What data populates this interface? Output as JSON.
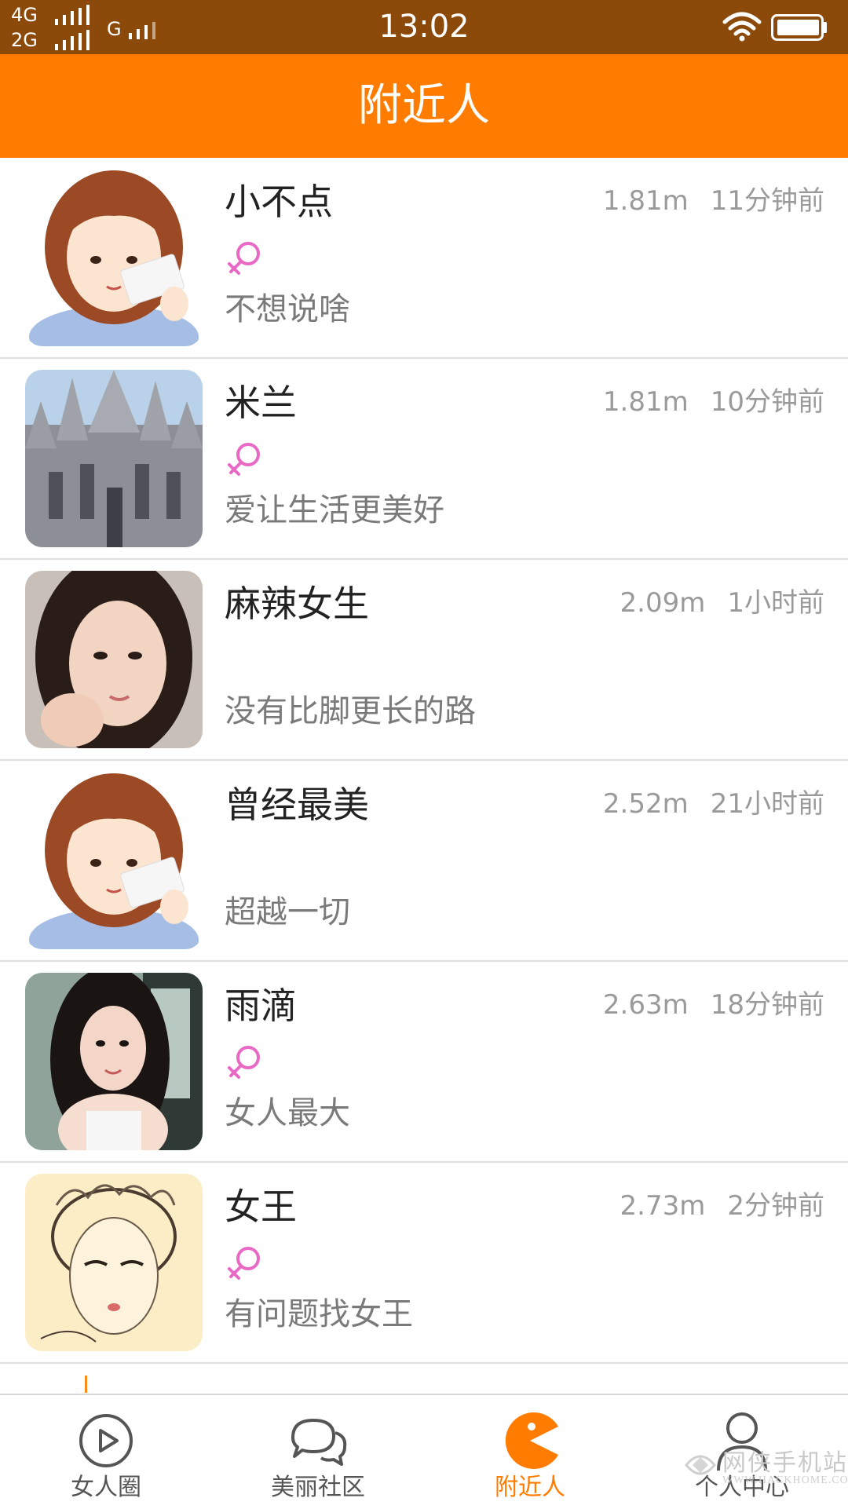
{
  "status_bar": {
    "network_top": "4G",
    "network_bottom": "2G",
    "network_g": "G",
    "time": "13:02"
  },
  "header": {
    "title": "附近人"
  },
  "users": [
    {
      "name": "小不点",
      "distance": "1.81m",
      "time": "11分钟前",
      "signature": "不想说啥",
      "gender": "female",
      "avatar": "cartoon-girl-avatar"
    },
    {
      "name": "米兰",
      "distance": "1.81m",
      "time": "10分钟前",
      "signature": "爱让生活更美好",
      "gender": "female",
      "avatar": "cathedral-photo-avatar"
    },
    {
      "name": "麻辣女生",
      "distance": "2.09m",
      "time": "1小时前",
      "signature": "没有比脚更长的路",
      "gender": "",
      "avatar": "girl-photo-avatar"
    },
    {
      "name": "曾经最美",
      "distance": "2.52m",
      "time": "21小时前",
      "signature": "超越一切",
      "gender": "",
      "avatar": "cartoon-girl-avatar"
    },
    {
      "name": "雨滴",
      "distance": "2.63m",
      "time": "18分钟前",
      "signature": "女人最大",
      "gender": "female",
      "avatar": "woman-photo-avatar"
    },
    {
      "name": "女王",
      "distance": "2.73m",
      "time": "2分钟前",
      "signature": "有问题找女王",
      "gender": "female",
      "avatar": "sketch-queen-avatar"
    }
  ],
  "bottom_nav": [
    {
      "label": "女人圈",
      "icon": "play-circle-icon",
      "active": false
    },
    {
      "label": "美丽社区",
      "icon": "chat-bubbles-icon",
      "active": false
    },
    {
      "label": "附近人",
      "icon": "pacman-icon",
      "active": true
    },
    {
      "label": "个人中心",
      "icon": "person-icon",
      "active": false
    }
  ],
  "watermark": {
    "text": "网侠手机站",
    "sub": "WWW.HACKHOME.COM"
  },
  "colors": {
    "status_bar": "#8c4a0a",
    "header": "#ff7c00",
    "accent": "#ff7c00",
    "female_symbol": "#e86ac4"
  }
}
